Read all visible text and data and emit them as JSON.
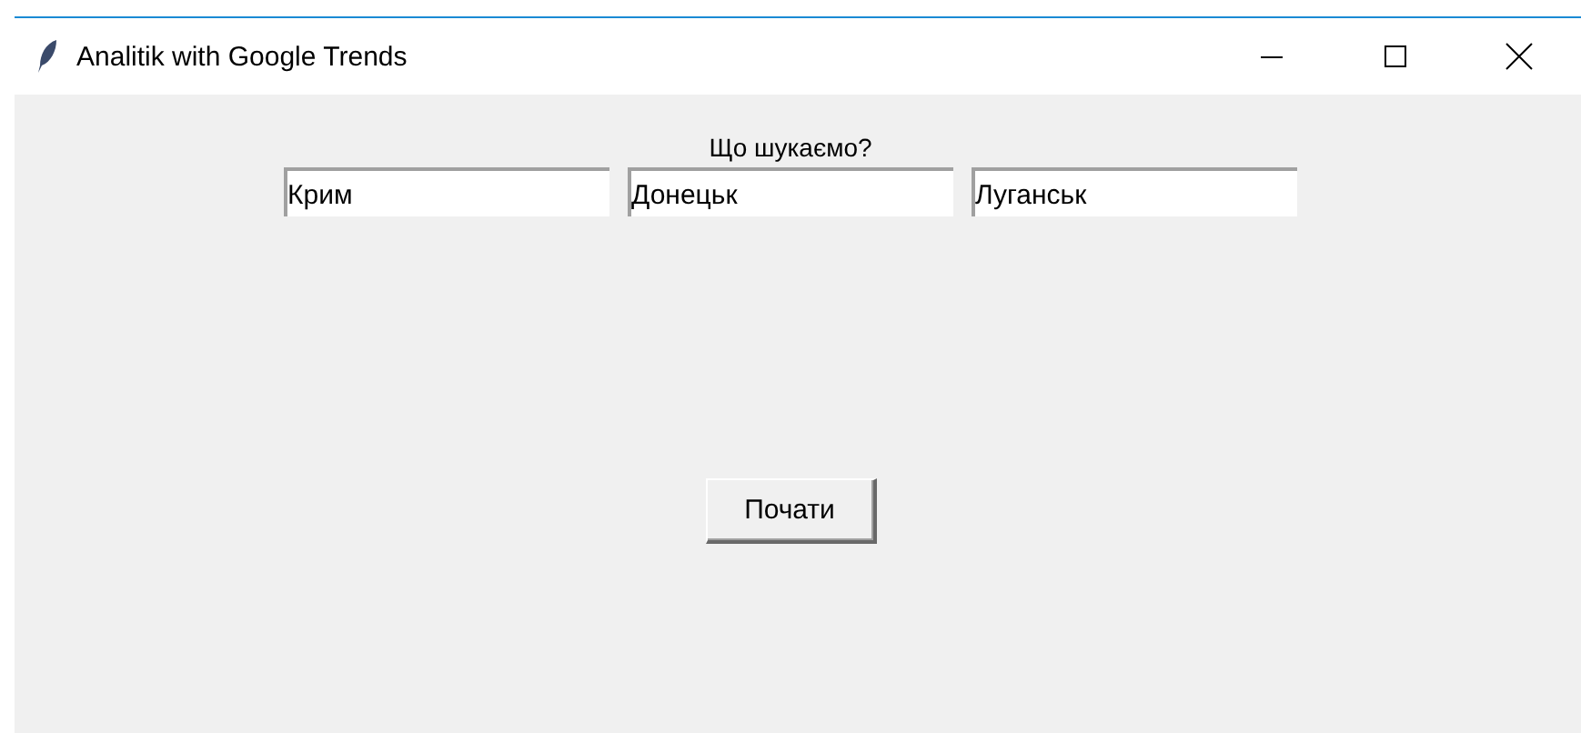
{
  "window": {
    "title": "Analitik with Google Trends"
  },
  "prompt": "Що шукаємо?",
  "fields": [
    {
      "value": "Крим"
    },
    {
      "value": "Донецьк"
    },
    {
      "value": "Луганськ"
    }
  ],
  "button": "Почати"
}
